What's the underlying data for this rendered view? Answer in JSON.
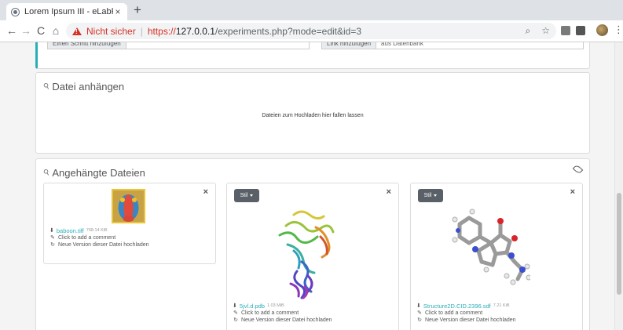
{
  "browser": {
    "tab_title": "Lorem Ipsum III - eLabFTW",
    "tab_close": "×",
    "new_tab": "+",
    "nav": {
      "back": "←",
      "forward": "→",
      "reload": "C",
      "home": "⌂"
    },
    "security_label": "Nicht sicher",
    "separator": "|",
    "url_scheme": "https://",
    "url_host": "127.0.0.1",
    "url_rest": "/experiments.php?mode=edit&id=3",
    "search_icon": "⌕",
    "star_icon": "☆",
    "menu": "⋮"
  },
  "steps": {
    "add_step_label": "Einen Schritt hinzufügen",
    "add_link_label": "Link hinzufügen",
    "link_field_value": "aus Datenbank"
  },
  "upload": {
    "title": "Datei anhängen",
    "dropzone_text": "Dateien zum Hochladen hier fallen lassen"
  },
  "attachments": {
    "title": "Angehängte Dateien",
    "style_button": "Stil",
    "close": "×",
    "files": [
      {
        "name": "baboon.tiff",
        "size": "768.14 KiB",
        "comment": "Click to add a comment",
        "reupload": "Neue Version dieser Datei hochladen"
      },
      {
        "name": "5jvl.d.pdb",
        "size": "1.03 MiB",
        "comment": "Click to add a comment",
        "reupload": "Neue Version dieser Datei hochladen"
      },
      {
        "name": "Structure2D.CID.2396.sdf",
        "size": "7.21 KiB",
        "comment": "Click to add a comment",
        "reupload": "Neue Version dieser Datei hochladen"
      }
    ]
  },
  "colors": {
    "accent": "#29aeb9",
    "insecure": "#d93025",
    "button_dark": "#5a6068"
  }
}
